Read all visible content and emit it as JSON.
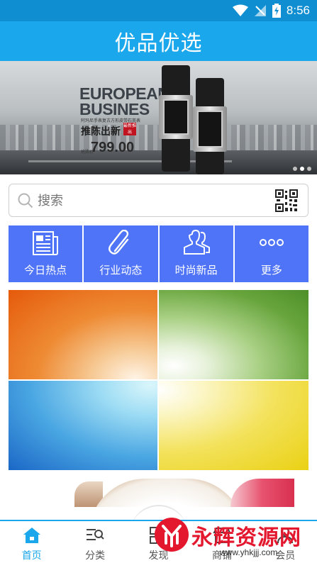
{
  "status_bar": {
    "time": "8:56",
    "icons": [
      "wifi-icon",
      "signal-icon",
      "battery-charging-icon"
    ]
  },
  "header": {
    "title": "优品优选"
  },
  "banner": {
    "headline_1": "EUROPEAN",
    "headline_2": "BUSINES",
    "small_text": "阿玛尼手表复古方形皮带石英表",
    "promo": "推陈出新",
    "tag": "最新推出",
    "price_label": "抢购价",
    "price": "799.00",
    "dots": 3,
    "active_dot": 2
  },
  "search": {
    "placeholder": "搜索",
    "icons": [
      "search-icon",
      "qr-code-icon"
    ]
  },
  "categories": [
    {
      "label": "今日热点",
      "icon": "newspaper-icon"
    },
    {
      "label": "行业动态",
      "icon": "paperclip-icon"
    },
    {
      "label": "时尚新品",
      "icon": "users-icon"
    },
    {
      "label": "更多",
      "icon": "more-dots-icon"
    }
  ],
  "tiles": [
    {
      "name": "orange"
    },
    {
      "name": "green"
    },
    {
      "name": "blue"
    },
    {
      "name": "yellow"
    }
  ],
  "tabs": [
    {
      "label": "首页",
      "icon": "home-icon",
      "active": true
    },
    {
      "label": "分类",
      "icon": "category-search-icon",
      "active": false
    },
    {
      "label": "发现",
      "icon": "discover-icon",
      "active": false
    },
    {
      "label": "商铺",
      "icon": "shop-icon",
      "active": false
    },
    {
      "label": "会员",
      "icon": "member-icon",
      "active": false
    }
  ],
  "watermark": {
    "text": "永辉资源网",
    "url": "www.yhkjjj.com"
  },
  "colors": {
    "primary": "#1aa7eb",
    "status": "#0f8fd1",
    "category": "#4f74f7",
    "watermark": "#e3172d"
  }
}
